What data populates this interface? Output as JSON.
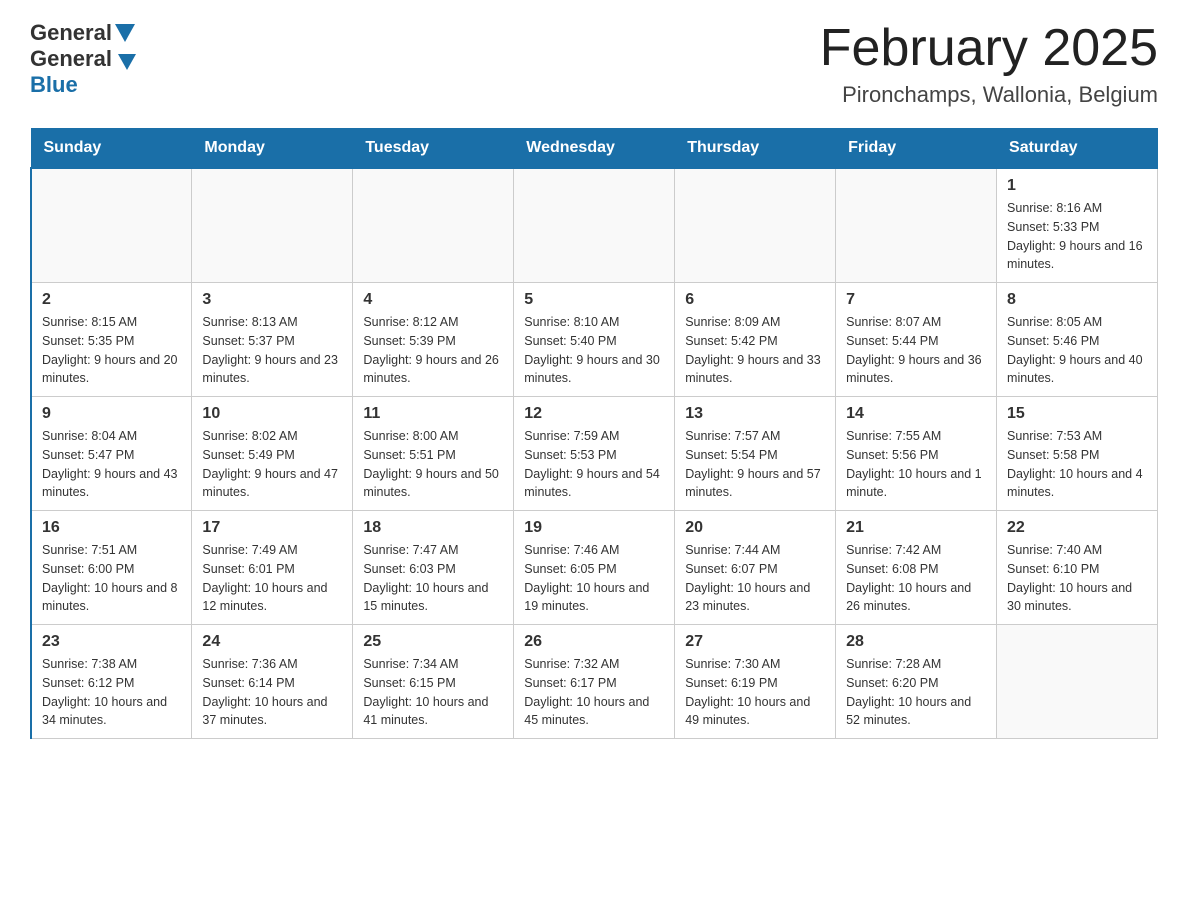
{
  "logo": {
    "general": "General",
    "blue": "Blue"
  },
  "header": {
    "title": "February 2025",
    "subtitle": "Pironchamps, Wallonia, Belgium"
  },
  "weekdays": [
    "Sunday",
    "Monday",
    "Tuesday",
    "Wednesday",
    "Thursday",
    "Friday",
    "Saturday"
  ],
  "weeks": [
    [
      {
        "day": "",
        "info": ""
      },
      {
        "day": "",
        "info": ""
      },
      {
        "day": "",
        "info": ""
      },
      {
        "day": "",
        "info": ""
      },
      {
        "day": "",
        "info": ""
      },
      {
        "day": "",
        "info": ""
      },
      {
        "day": "1",
        "info": "Sunrise: 8:16 AM\nSunset: 5:33 PM\nDaylight: 9 hours and 16 minutes."
      }
    ],
    [
      {
        "day": "2",
        "info": "Sunrise: 8:15 AM\nSunset: 5:35 PM\nDaylight: 9 hours and 20 minutes."
      },
      {
        "day": "3",
        "info": "Sunrise: 8:13 AM\nSunset: 5:37 PM\nDaylight: 9 hours and 23 minutes."
      },
      {
        "day": "4",
        "info": "Sunrise: 8:12 AM\nSunset: 5:39 PM\nDaylight: 9 hours and 26 minutes."
      },
      {
        "day": "5",
        "info": "Sunrise: 8:10 AM\nSunset: 5:40 PM\nDaylight: 9 hours and 30 minutes."
      },
      {
        "day": "6",
        "info": "Sunrise: 8:09 AM\nSunset: 5:42 PM\nDaylight: 9 hours and 33 minutes."
      },
      {
        "day": "7",
        "info": "Sunrise: 8:07 AM\nSunset: 5:44 PM\nDaylight: 9 hours and 36 minutes."
      },
      {
        "day": "8",
        "info": "Sunrise: 8:05 AM\nSunset: 5:46 PM\nDaylight: 9 hours and 40 minutes."
      }
    ],
    [
      {
        "day": "9",
        "info": "Sunrise: 8:04 AM\nSunset: 5:47 PM\nDaylight: 9 hours and 43 minutes."
      },
      {
        "day": "10",
        "info": "Sunrise: 8:02 AM\nSunset: 5:49 PM\nDaylight: 9 hours and 47 minutes."
      },
      {
        "day": "11",
        "info": "Sunrise: 8:00 AM\nSunset: 5:51 PM\nDaylight: 9 hours and 50 minutes."
      },
      {
        "day": "12",
        "info": "Sunrise: 7:59 AM\nSunset: 5:53 PM\nDaylight: 9 hours and 54 minutes."
      },
      {
        "day": "13",
        "info": "Sunrise: 7:57 AM\nSunset: 5:54 PM\nDaylight: 9 hours and 57 minutes."
      },
      {
        "day": "14",
        "info": "Sunrise: 7:55 AM\nSunset: 5:56 PM\nDaylight: 10 hours and 1 minute."
      },
      {
        "day": "15",
        "info": "Sunrise: 7:53 AM\nSunset: 5:58 PM\nDaylight: 10 hours and 4 minutes."
      }
    ],
    [
      {
        "day": "16",
        "info": "Sunrise: 7:51 AM\nSunset: 6:00 PM\nDaylight: 10 hours and 8 minutes."
      },
      {
        "day": "17",
        "info": "Sunrise: 7:49 AM\nSunset: 6:01 PM\nDaylight: 10 hours and 12 minutes."
      },
      {
        "day": "18",
        "info": "Sunrise: 7:47 AM\nSunset: 6:03 PM\nDaylight: 10 hours and 15 minutes."
      },
      {
        "day": "19",
        "info": "Sunrise: 7:46 AM\nSunset: 6:05 PM\nDaylight: 10 hours and 19 minutes."
      },
      {
        "day": "20",
        "info": "Sunrise: 7:44 AM\nSunset: 6:07 PM\nDaylight: 10 hours and 23 minutes."
      },
      {
        "day": "21",
        "info": "Sunrise: 7:42 AM\nSunset: 6:08 PM\nDaylight: 10 hours and 26 minutes."
      },
      {
        "day": "22",
        "info": "Sunrise: 7:40 AM\nSunset: 6:10 PM\nDaylight: 10 hours and 30 minutes."
      }
    ],
    [
      {
        "day": "23",
        "info": "Sunrise: 7:38 AM\nSunset: 6:12 PM\nDaylight: 10 hours and 34 minutes."
      },
      {
        "day": "24",
        "info": "Sunrise: 7:36 AM\nSunset: 6:14 PM\nDaylight: 10 hours and 37 minutes."
      },
      {
        "day": "25",
        "info": "Sunrise: 7:34 AM\nSunset: 6:15 PM\nDaylight: 10 hours and 41 minutes."
      },
      {
        "day": "26",
        "info": "Sunrise: 7:32 AM\nSunset: 6:17 PM\nDaylight: 10 hours and 45 minutes."
      },
      {
        "day": "27",
        "info": "Sunrise: 7:30 AM\nSunset: 6:19 PM\nDaylight: 10 hours and 49 minutes."
      },
      {
        "day": "28",
        "info": "Sunrise: 7:28 AM\nSunset: 6:20 PM\nDaylight: 10 hours and 52 minutes."
      },
      {
        "day": "",
        "info": ""
      }
    ]
  ]
}
